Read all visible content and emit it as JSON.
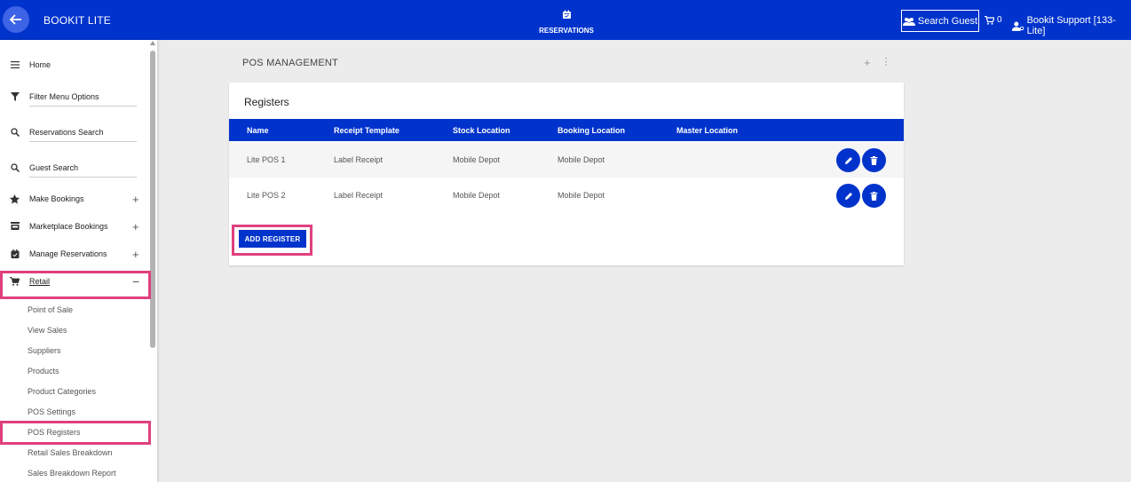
{
  "header": {
    "app_title": "BOOKIT LITE",
    "center_label": "RESERVATIONS",
    "search_guest": "Search Guest",
    "cart_count": "0",
    "user": "Bookit Support [133-Lite]"
  },
  "sidebar": {
    "items": [
      {
        "label": "Home"
      },
      {
        "label": "Filter Menu Options"
      },
      {
        "label": "Reservations Search"
      },
      {
        "label": "Guest Search"
      },
      {
        "label": "Make Bookings"
      },
      {
        "label": "Marketplace Bookings"
      },
      {
        "label": "Manage Reservations"
      },
      {
        "label": "Retail"
      }
    ],
    "retail_sub": [
      {
        "label": "Point of Sale"
      },
      {
        "label": "View Sales"
      },
      {
        "label": "Suppliers"
      },
      {
        "label": "Products"
      },
      {
        "label": "Product Categories"
      },
      {
        "label": "POS Settings"
      },
      {
        "label": "POS Registers"
      },
      {
        "label": "Retail Sales Breakdown"
      },
      {
        "label": "Sales Breakdown Report"
      }
    ]
  },
  "main": {
    "title": "POS MANAGEMENT",
    "card_title": "Registers",
    "columns": [
      "Name",
      "Receipt Template",
      "Stock Location",
      "Booking Location",
      "Master Location"
    ],
    "rows": [
      {
        "name": "Lite POS 1",
        "receipt": "Label Receipt",
        "stock": "Mobile Depot",
        "booking": "Mobile Depot",
        "master": ""
      },
      {
        "name": "Lite POS 2",
        "receipt": "Label Receipt",
        "stock": "Mobile Depot",
        "booking": "Mobile Depot",
        "master": ""
      }
    ],
    "add_button": "ADD REGISTER"
  },
  "colors": {
    "brand": "#0033cc",
    "highlight": "#e0407d"
  }
}
